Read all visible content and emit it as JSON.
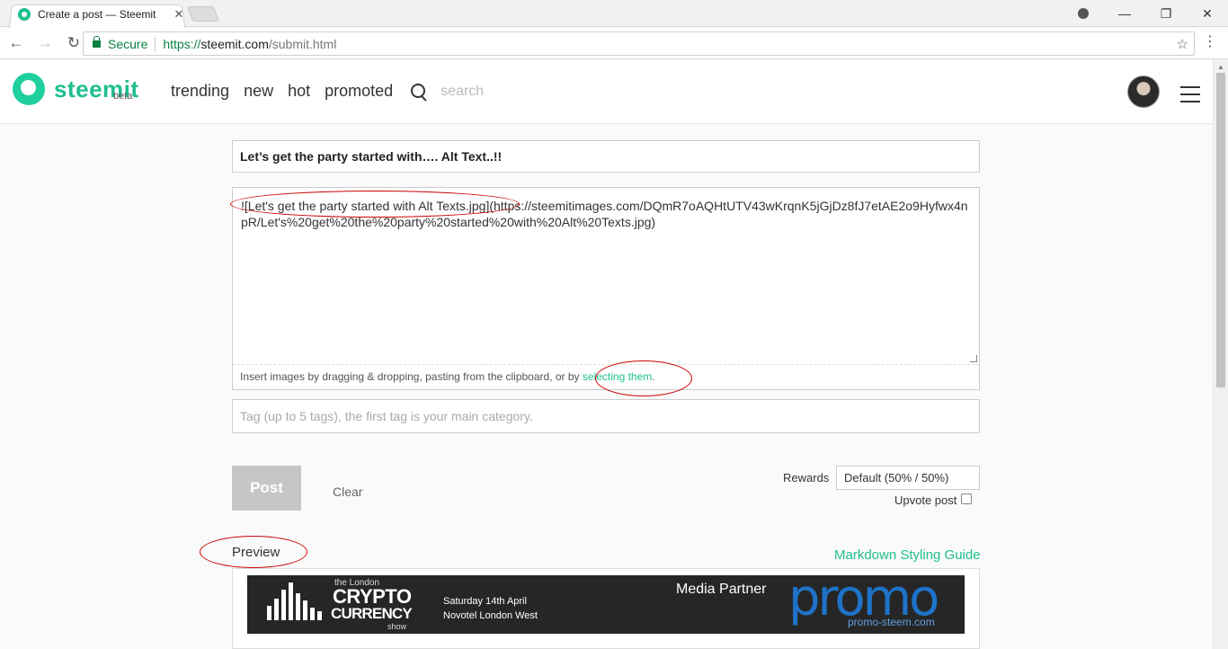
{
  "browser": {
    "tab_title": "Create a post — Steemit",
    "tab_close": "✕",
    "secure_label": "Secure",
    "url_scheme": "https://",
    "url_host": "steemit.com",
    "url_path": "/submit.html",
    "back": "←",
    "forward": "→",
    "reload": "↻",
    "star": "☆",
    "menu": "⋮",
    "minimize": "—",
    "restore": "❐",
    "close": "✕"
  },
  "header": {
    "logo_text": "steemit",
    "logo_beta": "beta",
    "nav": [
      "trending",
      "new",
      "hot",
      "promoted"
    ],
    "search_placeholder": "search"
  },
  "form": {
    "title_value": "Let’s get the party started with…. Alt Text..!!",
    "body_value": "![Let's get the party started with Alt Texts.jpg](https://steemitimages.com/DQmR7oAQHtUTV43wKrqnK5jGjDz8fJ7etAE2o9Hyfwx4npR/Let's%20get%20the%20party%20started%20with%20Alt%20Texts.jpg)",
    "insert_hint": "Insert images by dragging & dropping, pasting from the clipboard, or by",
    "insert_link": "selecting them",
    "insert_end": ".",
    "tag_placeholder": "Tag (up to 5 tags), the first tag is your main category.",
    "post_label": "Post",
    "clear_label": "Clear",
    "rewards_label": "Rewards",
    "rewards_value": "Default (50% / 50%)",
    "upvote_label": "Upvote post"
  },
  "preview": {
    "label": "Preview",
    "guide_link": "Markdown Styling Guide",
    "banner": {
      "london": "the London",
      "crypto": "CRYPTO",
      "currency": "CURRENCY",
      "show": "show",
      "date": "Saturday 14th April",
      "venue": "Novotel London West",
      "media_partner": "Media Partner",
      "promo": "promo",
      "promo_url": "promo-steem.com"
    }
  },
  "colors": {
    "brand": "#1fbf8f",
    "annotation": "#cc0000",
    "promo_blue": "#1e73c8"
  }
}
